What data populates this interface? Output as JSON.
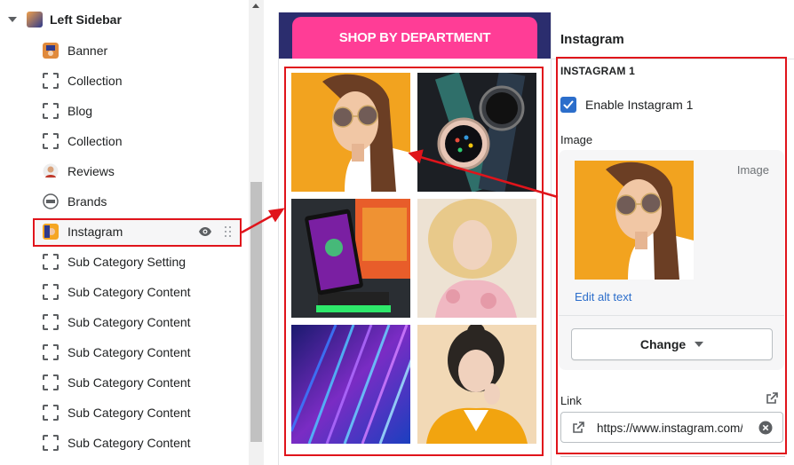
{
  "sidebar": {
    "header_label": "Left Sidebar",
    "items": [
      {
        "label": "Banner",
        "icon": "banner-thumb-icon"
      },
      {
        "label": "Collection",
        "icon": "section-dashed-icon"
      },
      {
        "label": "Blog",
        "icon": "section-dashed-icon"
      },
      {
        "label": "Collection",
        "icon": "section-dashed-icon"
      },
      {
        "label": "Reviews",
        "icon": "reviews-thumb-icon"
      },
      {
        "label": "Brands",
        "icon": "brands-thumb-icon"
      },
      {
        "label": "Instagram",
        "icon": "instagram-thumb-icon",
        "active": true
      },
      {
        "label": "Sub Category Setting",
        "icon": "section-dashed-icon"
      },
      {
        "label": "Sub Category Content",
        "icon": "section-dashed-icon"
      },
      {
        "label": "Sub Category Content",
        "icon": "section-dashed-icon"
      },
      {
        "label": "Sub Category Content",
        "icon": "section-dashed-icon"
      },
      {
        "label": "Sub Category Content",
        "icon": "section-dashed-icon"
      },
      {
        "label": "Sub Category Content",
        "icon": "section-dashed-icon"
      },
      {
        "label": "Sub Category Content",
        "icon": "section-dashed-icon"
      }
    ]
  },
  "preview": {
    "button_label": "SHOP BY DEPARTMENT",
    "images": [
      "woman-sunglasses-photo",
      "smartwatch-photo",
      "phone-charger-photo",
      "curly-hair-woman-photo",
      "abstract-light-photo",
      "girl-yellow-jacket-photo"
    ]
  },
  "panel": {
    "title": "Instagram",
    "section_title": "INSTAGRAM 1",
    "enable_label": "Enable Instagram 1",
    "enable_checked": true,
    "image_label": "Image",
    "image_type": "Image",
    "alt_link": "Edit alt text",
    "change_button": "Change",
    "link_label": "Link",
    "link_value": "https://www.instagram.com/"
  },
  "colors": {
    "accent": "#2c6ecb",
    "shop_button": "#ff3d96",
    "banner_bg": "#2b2d6e",
    "annotation_red": "#e0141b"
  }
}
